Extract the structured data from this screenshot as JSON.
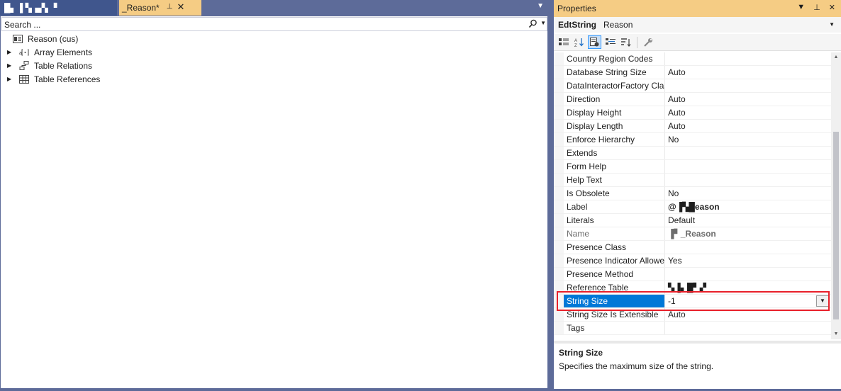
{
  "tabs": {
    "inactive_title": "█▖▐ ▚▗▞▖ ▘",
    "active_title": "_Reason*",
    "pin_glyph": "⊥",
    "close_glyph": "✕",
    "dropdown_glyph": "▼"
  },
  "search": {
    "placeholder": "Search ...",
    "value": ""
  },
  "tree": {
    "root_label": "Reason (cus)",
    "children": [
      {
        "label": "Array Elements",
        "icon": "array-elements-icon"
      },
      {
        "label": "Table Relations",
        "icon": "table-relations-icon"
      },
      {
        "label": "Table References",
        "icon": "table-references-icon"
      }
    ]
  },
  "properties": {
    "title": "Properties",
    "object_type": "EdtString",
    "object_name": "Reason",
    "rows": [
      {
        "name": "Country Region Codes",
        "value": ""
      },
      {
        "name": "Database String Size",
        "value": "Auto"
      },
      {
        "name": "DataInteractorFactory Class",
        "value": ""
      },
      {
        "name": "Direction",
        "value": "Auto"
      },
      {
        "name": "Display Height",
        "value": "Auto"
      },
      {
        "name": "Display Length",
        "value": "Auto"
      },
      {
        "name": "Enforce Hierarchy",
        "value": "No"
      },
      {
        "name": "Extends",
        "value": ""
      },
      {
        "name": "Form Help",
        "value": ""
      },
      {
        "name": "Help Text",
        "value": ""
      },
      {
        "name": "Is Obsolete",
        "value": "No"
      },
      {
        "name": "Label",
        "value": "@▐▚█eason",
        "style": "bold"
      },
      {
        "name": "Literals",
        "value": "Default"
      },
      {
        "name": "Name",
        "value": "▐▘_Reason",
        "style": "readonly"
      },
      {
        "name": "Presence Class",
        "value": ""
      },
      {
        "name": "Presence Indicator Allowed",
        "value": "Yes"
      },
      {
        "name": "Presence Method",
        "value": ""
      },
      {
        "name": "Reference Table",
        "value": "▚▐▖█▘▞"
      },
      {
        "name": "String Size",
        "value": "-1",
        "style": "selected"
      },
      {
        "name": "String Size Is Extensible",
        "value": "Auto"
      },
      {
        "name": "Tags",
        "value": ""
      }
    ],
    "description": {
      "title": "String Size",
      "text": "Specifies the maximum size of the string."
    }
  }
}
